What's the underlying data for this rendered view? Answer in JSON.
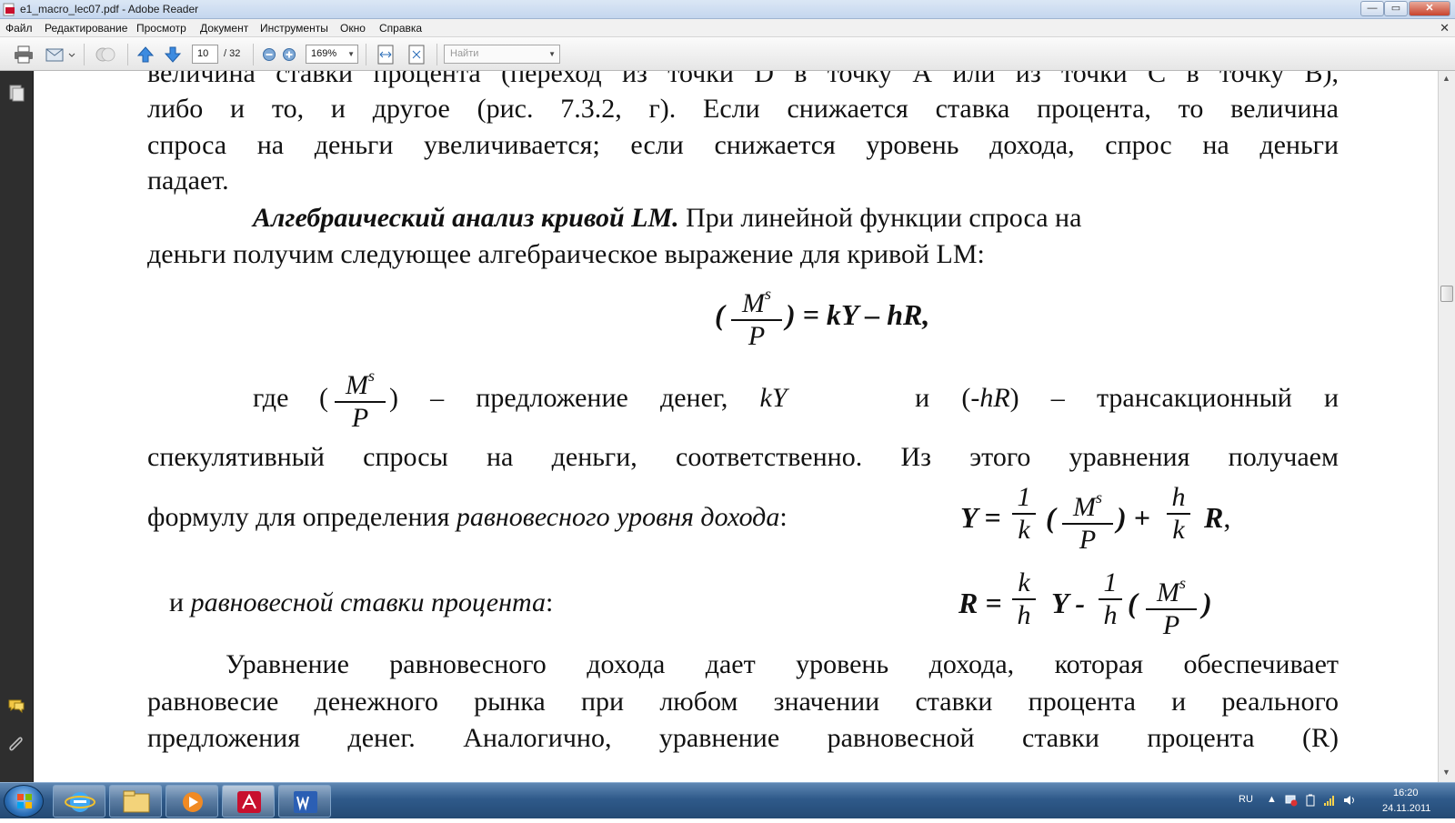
{
  "window": {
    "title": "e1_macro_lec07.pdf - Adobe Reader",
    "min_label": "—",
    "max_label": "▭",
    "close_label": "✕"
  },
  "menu": {
    "items": [
      "Файл",
      "Редактирование",
      "Просмотр",
      "Документ",
      "Инструменты",
      "Окно",
      "Справка"
    ],
    "close_doc": "✕"
  },
  "toolbar": {
    "page_current": "10",
    "page_total": "/ 32",
    "zoom": "169%",
    "search_placeholder": "Найти"
  },
  "document": {
    "lines": [
      "величина ставки процента (переход из точки D в точку А или из точки С в точку B),",
      "либо и то, и другое (рис. 7.3.2, г). Если снижается ставка процента, то величина",
      "спроса на деньги увеличивается; если снижается уровень дохода, спрос на деньги",
      "падает."
    ],
    "heading_bold": "Алгебраический анализ кривой LM.",
    "heading_rest": "При линейной функции спроса на",
    "line_after_heading": "деньги получим следующее алгебраическое выражение для кривой LM:",
    "eq1": {
      "num": "M",
      "sup": "s",
      "den": "P",
      "rest": ") = kY – hR,"
    },
    "where": {
      "word": "где",
      "text1": ") – предложение денег,",
      "ky": "kY",
      "text2": "и (-",
      "hr": "hR",
      "text3": ") – трансакционный и"
    },
    "line_speculative": "спекулятивный спросы на деньги, соответственно. Из этого уравнения получаем",
    "formula_line_prefix": "формулу для определения",
    "formula_line_italic": "равновесного уровня дохода",
    "formula_line_colon": ":",
    "eqY": {
      "lhs": "Y =",
      "one": "1",
      "k": "k",
      "M": "M",
      "s": "s",
      "P": "P",
      "plus": ") +",
      "h": "h",
      "R": "R",
      "comma": ","
    },
    "rate_prefix": "и",
    "rate_italic": "равновесной ставки процента",
    "rate_colon": ":",
    "eqR": {
      "lhs": "R =",
      "k": "k",
      "h": "h",
      "mid": "Y -",
      "one": "1",
      "M": "M",
      "s": "s",
      "P": "P"
    },
    "final_lines": [
      "Уравнение равновесного дохода дает уровень дохода, которая обеспечивает",
      "равновесие денежного рынка при любом значении ставки процента и реального",
      "предложения денег. Аналогично, уравнение равновесной ставки процента (R)"
    ]
  },
  "taskbar": {
    "lang": "RU",
    "time": "16:20",
    "date": "24.11.2011"
  }
}
